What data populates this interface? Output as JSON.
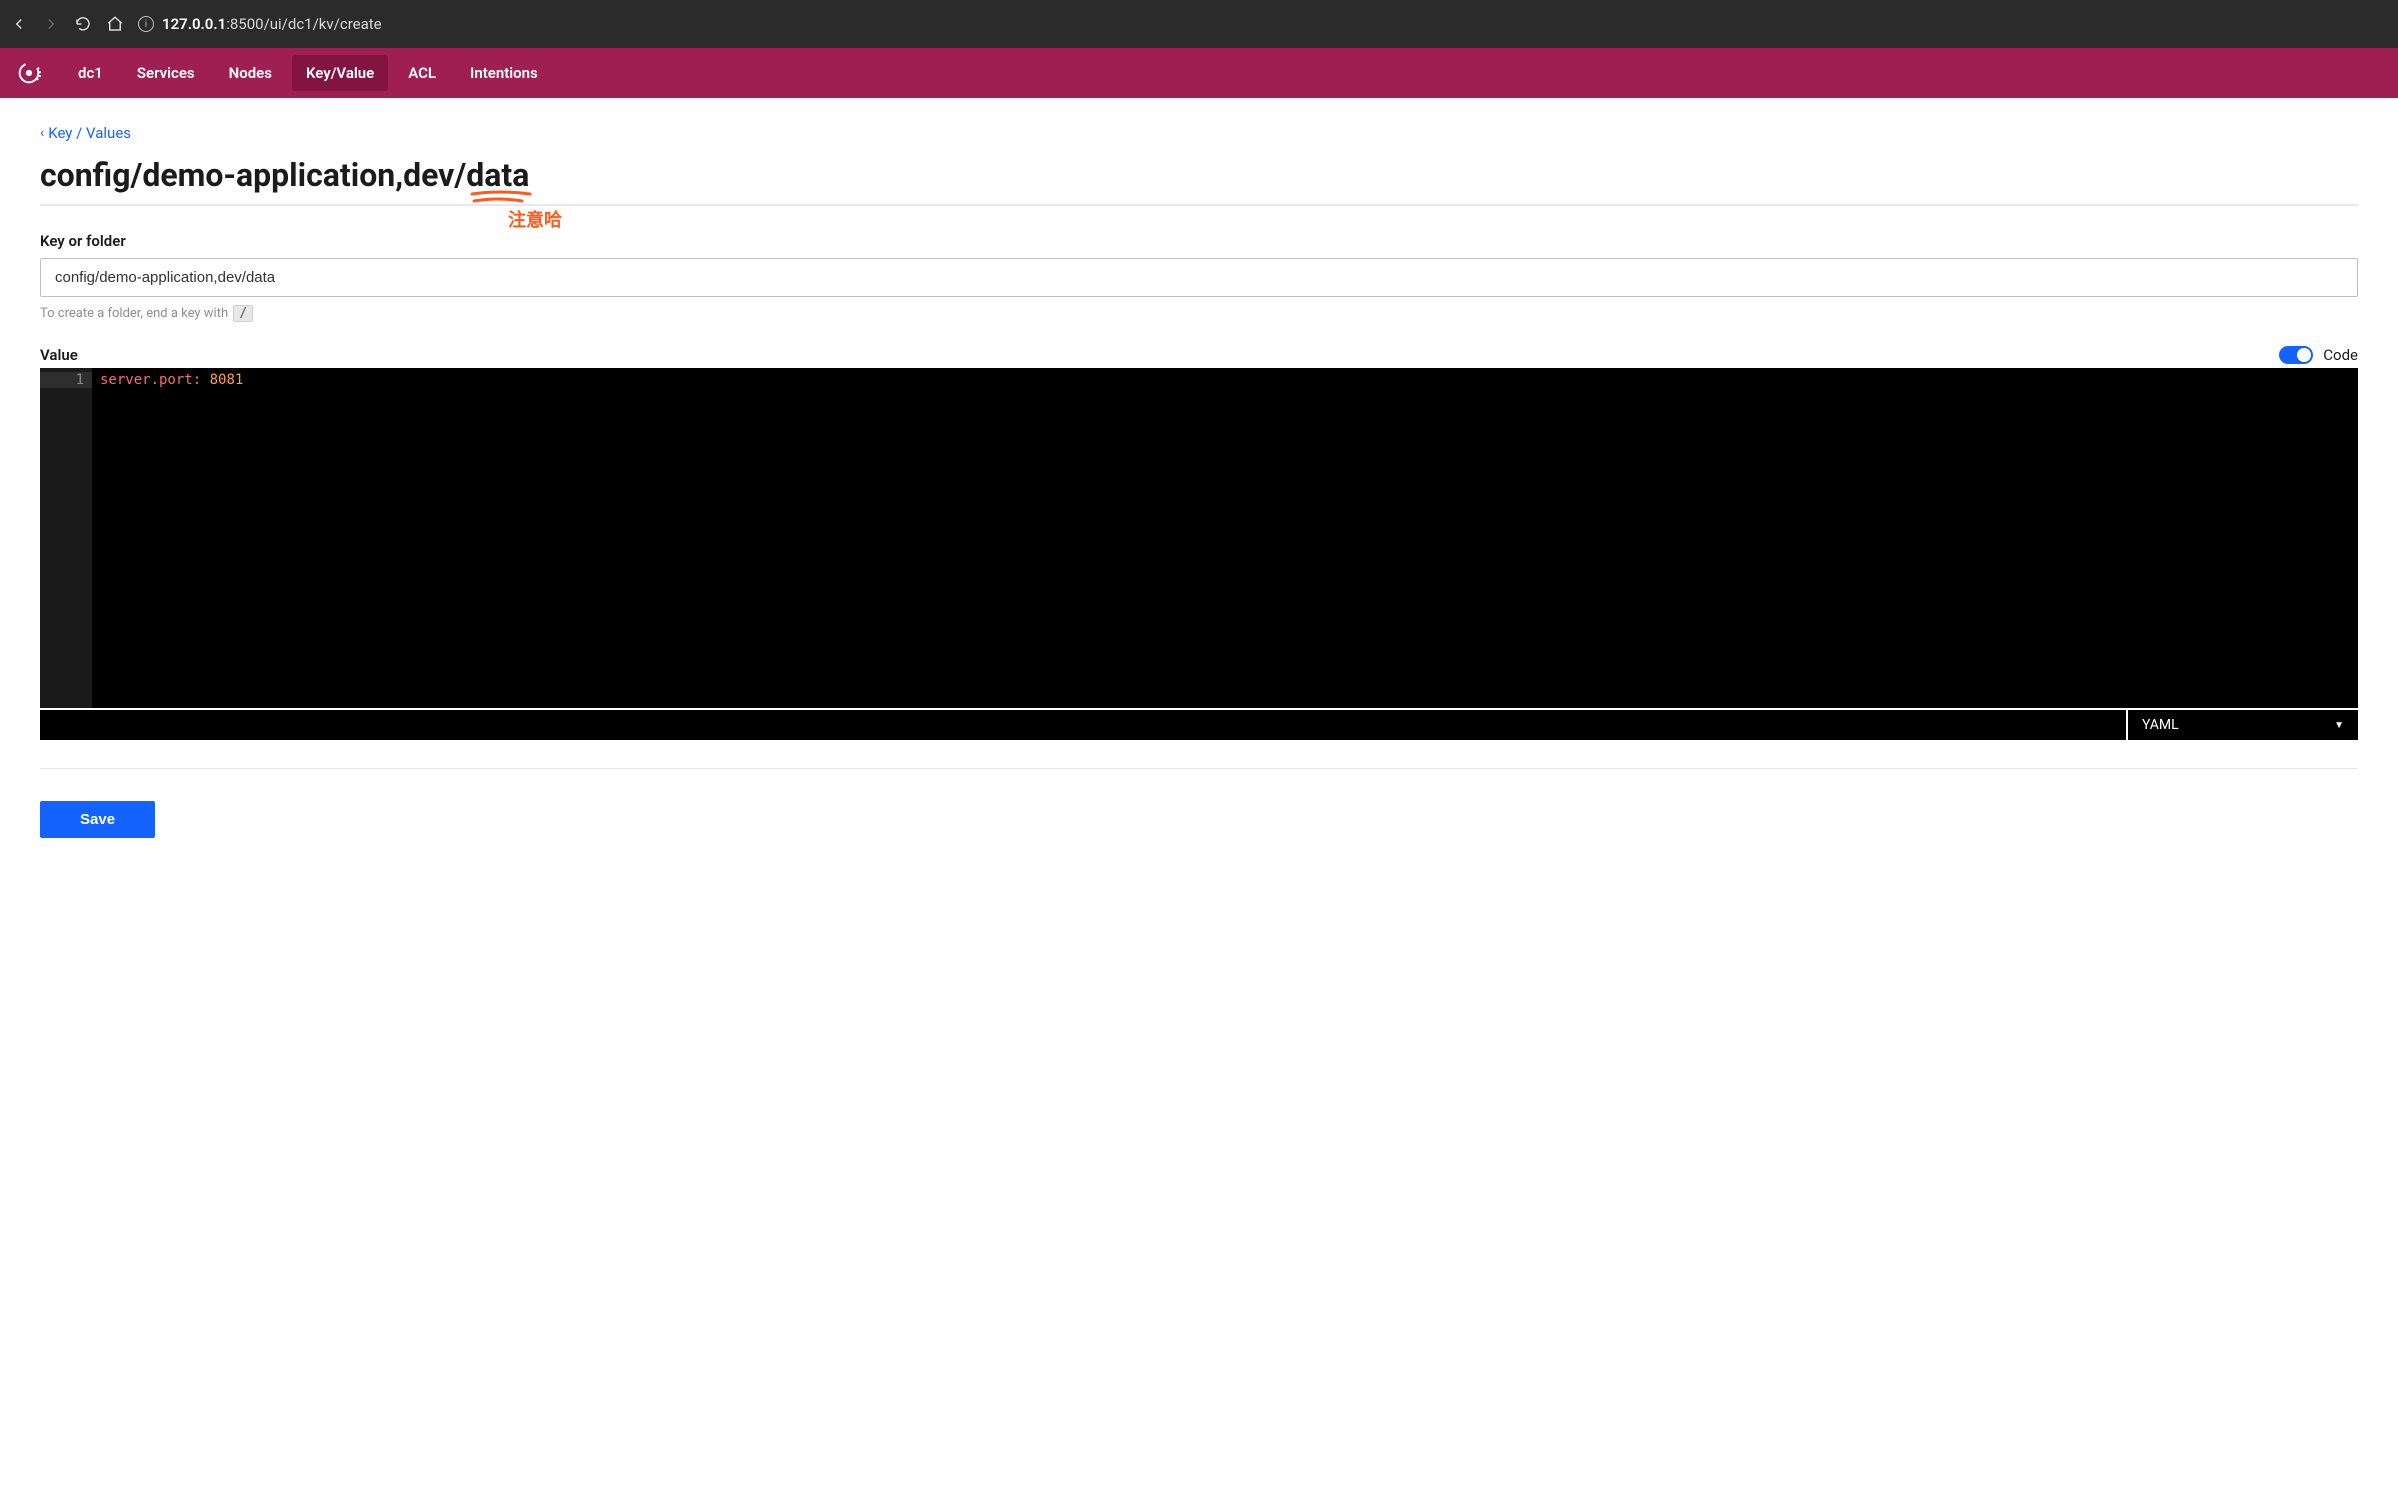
{
  "browser": {
    "url_host": "127.0.0.1",
    "url_port": ":8500",
    "url_path": "/ui/dc1/kv/create"
  },
  "nav": {
    "datacenter": "dc1",
    "items": [
      {
        "label": "Services"
      },
      {
        "label": "Nodes"
      },
      {
        "label": "Key/Value"
      },
      {
        "label": "ACL"
      },
      {
        "label": "Intentions"
      }
    ]
  },
  "breadcrumb": {
    "label": "Key / Values"
  },
  "page_title": "config/demo-application,dev/data",
  "annotation": {
    "note": "注意哈"
  },
  "key_field": {
    "label": "Key or folder",
    "value": "config/demo-application,dev/data",
    "hint_prefix": "To create a folder, end a key with",
    "hint_key": "/"
  },
  "value_field": {
    "label": "Value",
    "code_toggle_label": "Code",
    "code": {
      "line_number": "1",
      "key": "server.port",
      "sep": ":",
      "value": "8081"
    },
    "format": "YAML"
  },
  "save_label": "Save"
}
